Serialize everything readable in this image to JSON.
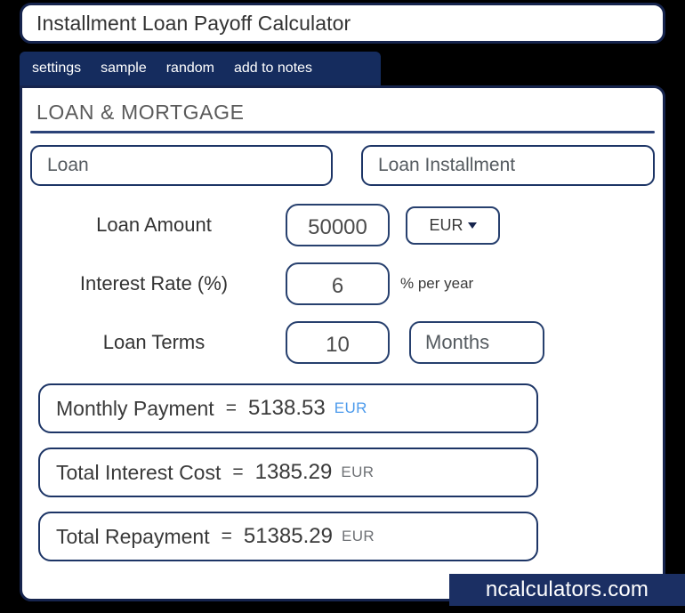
{
  "window": {
    "title": "Installment Loan Payoff Calculator"
  },
  "tabs": [
    {
      "label": "settings"
    },
    {
      "label": "sample"
    },
    {
      "label": "random"
    },
    {
      "label": "add to notes"
    }
  ],
  "section": {
    "title": "LOAN & MORTGAGE"
  },
  "categories": [
    {
      "label": "Loan"
    },
    {
      "label": "Loan Installment"
    }
  ],
  "fields": [
    {
      "label": "Loan Amount",
      "value": "50000",
      "currency": "EUR"
    },
    {
      "label": "Interest Rate (%)",
      "value": "6",
      "unit": "% per year"
    },
    {
      "label": "Loan Terms",
      "value": "10",
      "period": "Months"
    }
  ],
  "results": [
    {
      "label": "Monthly Payment",
      "equals": "=",
      "value": "5138.53",
      "unit": "EUR"
    },
    {
      "label": "Total Interest Cost",
      "equals": "=",
      "value": "1385.29",
      "unit": "EUR"
    },
    {
      "label": "Total Repayment",
      "equals": "=",
      "value": "51385.29",
      "unit": "EUR"
    }
  ],
  "brand": {
    "name": "ncalculators.com"
  },
  "colors": {
    "navy": "#152c5e",
    "border": "#1d3566",
    "accent_blue": "#4d9bec",
    "panel_bg": "#ffffff",
    "page_bg": "#000000"
  }
}
